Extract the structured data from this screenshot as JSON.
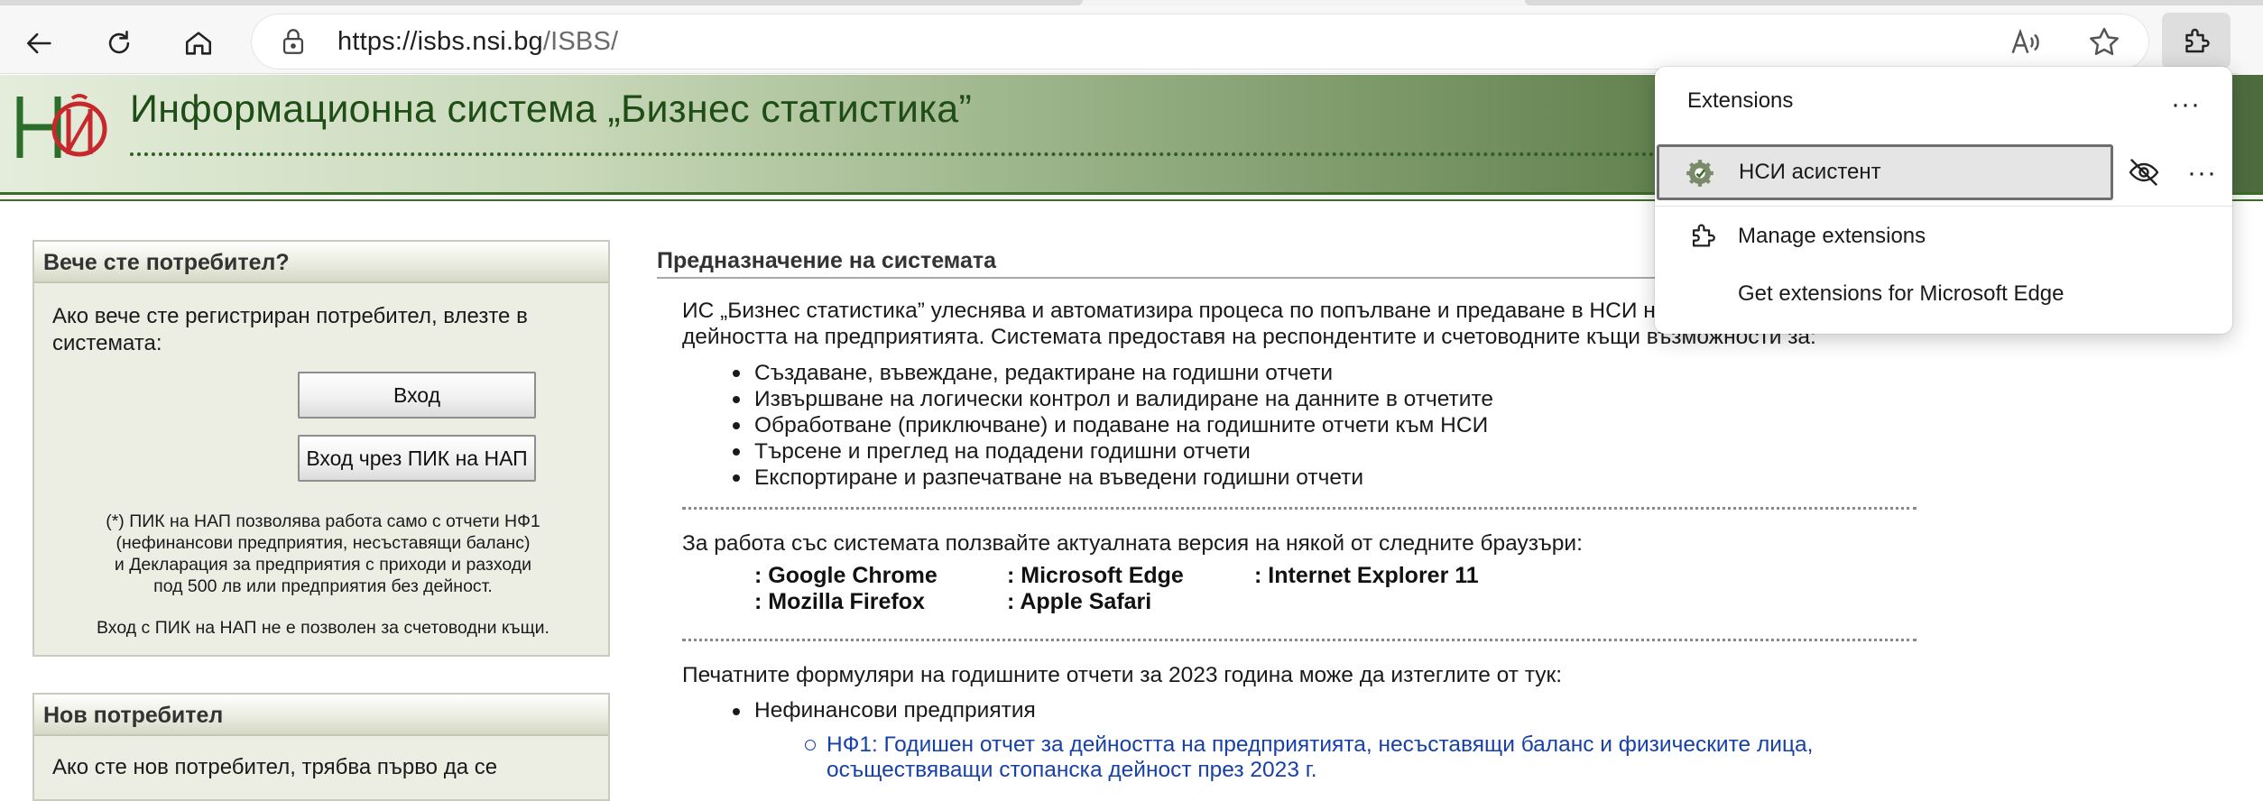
{
  "browser": {
    "url_host": "https://isbs.nsi.bg",
    "url_path": "/ISBS/"
  },
  "header": {
    "title": "Информационна система „Бизнес статистика”"
  },
  "login_panel": {
    "title": "Вече сте потребител?",
    "text_line1": "Ако вече сте регистриран потребител, влезте в",
    "text_line2": "системата:",
    "login_button": "Вход",
    "pik_button": "Вход чрез ПИК на НАП",
    "note_line1": "(*) ПИК на НАП позволява работа само с отчети НФ1",
    "note_line2": "(нефинансови предприятия, несъставящи баланс)",
    "note_line3": "и Декларация за предприятия с приходи и разходи",
    "note_line4": "под 500 лв или предприятия без дейност.",
    "note_line5": "Вход с ПИК на НАП не е позволен за счетоводни къщи."
  },
  "new_user_panel": {
    "title": "Нов потребител",
    "text_line1": "Ако сте нов потребител, трябва първо да се"
  },
  "main": {
    "section_title": "Предназначение на системата",
    "intro_line1": "ИС „Бизнес статистика” улеснява и автоматизира процеса по попълване и предаване в НСИ на г",
    "intro_line2": "дейността на предприятията. Системата предоставя на респондентите и счетоводните къщи възможности за:",
    "features": [
      "Създаване, въвеждане, редактиране на годишни отчети",
      "Извършване на логически контрол и валидиране на данните в отчетите",
      "Обработване (приключване) и подаване на годишните отчети към НСИ",
      "Търсене и преглед на подадени годишни отчети",
      "Експортиране и разпечатване на въведени годишни отчети"
    ],
    "browsers_intro": "За работа със системата ползвайте актуалната версия на някой от следните браузъри:",
    "browsers": [
      ": Google Chrome",
      ": Microsoft Edge",
      ": Internet Explorer 11",
      ": Mozilla Firefox",
      ": Apple Safari"
    ],
    "forms_intro": "Печатните формуляри на годишните отчети за 2023 година може да изтеглите от тук:",
    "forms_category": "Нефинансови предприятия",
    "form_link_line1": "НФ1: Годишен отчет за дейността на предприятията, несъставящи баланс и физическите лица,",
    "form_link_line2": "осъществяващи стопанска дейност през 2023 г."
  },
  "extensions_popup": {
    "title": "Extensions",
    "more_glyph": "···",
    "extension_name": "НСИ асистент",
    "manage": "Manage extensions",
    "get": "Get extensions for Microsoft Edge"
  },
  "icons": [
    "back-icon",
    "refresh-icon",
    "home-icon",
    "lock-icon",
    "read-aloud-icon",
    "favorite-star-icon",
    "extensions-puzzle-icon",
    "hide-eye-icon",
    "gear-icon"
  ],
  "colors": {
    "header_title": "#1f4d16",
    "link": "#1740a8",
    "panel_bg": "#eceee4"
  }
}
